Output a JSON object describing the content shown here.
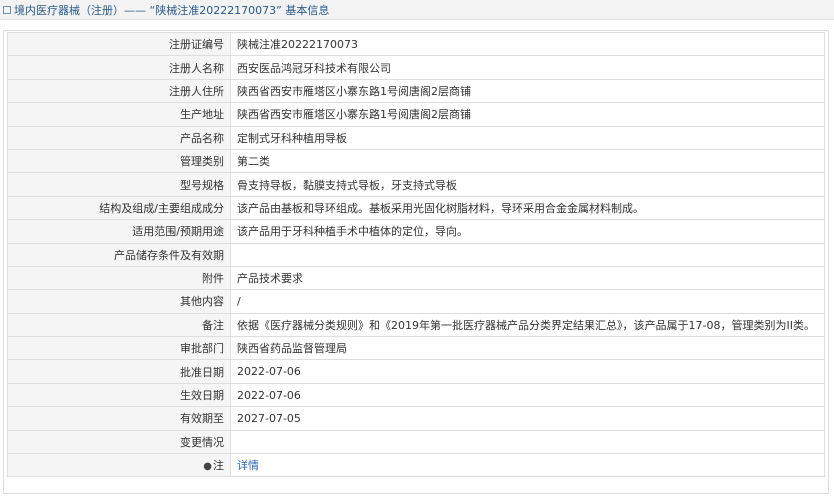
{
  "header": {
    "title": "境内医疗器械（注册）—— “陕械注准20222170073” 基本信息"
  },
  "rows": [
    {
      "label": "注册证编号",
      "value": "陕械注准20222170073"
    },
    {
      "label": "注册人名称",
      "value": "西安医品鸿冠牙科技术有限公司"
    },
    {
      "label": "注册人住所",
      "value": "陕西省西安市雁塔区小寨东路1号阅唐阁2层商铺"
    },
    {
      "label": "生产地址",
      "value": "陕西省西安市雁塔区小寨东路1号阅唐阁2层商铺"
    },
    {
      "label": "产品名称",
      "value": "定制式牙科种植用导板"
    },
    {
      "label": "管理类别",
      "value": "第二类"
    },
    {
      "label": "型号规格",
      "value": "骨支持导板，黏膜支持式导板，牙支持式导板"
    },
    {
      "label": "结构及组成/主要组成成分",
      "value": "该产品由基板和导环组成。基板采用光固化树脂材料，导环采用合金金属材料制成。"
    },
    {
      "label": "适用范围/预期用途",
      "value": "该产品用于牙科种植手术中植体的定位，导向。"
    },
    {
      "label": "产品储存条件及有效期",
      "value": ""
    },
    {
      "label": "附件",
      "value": "产品技术要求"
    },
    {
      "label": "其他内容",
      "value": "/"
    },
    {
      "label": "备注",
      "value": "依据《医疗器械分类规则》和《2019年第一批医疗器械产品分类界定结果汇总》，该产品属于17-08，管理类别为II类。"
    },
    {
      "label": "审批部门",
      "value": "陕西省药品监督管理局"
    },
    {
      "label": "批准日期",
      "value": "2022-07-06"
    },
    {
      "label": "生效日期",
      "value": "2022-07-06"
    },
    {
      "label": "有效期至",
      "value": "2027-07-05"
    },
    {
      "label": "变更情况",
      "value": ""
    }
  ],
  "note": {
    "icon": "pin-icon",
    "label": "注",
    "link_text": "详情"
  }
}
